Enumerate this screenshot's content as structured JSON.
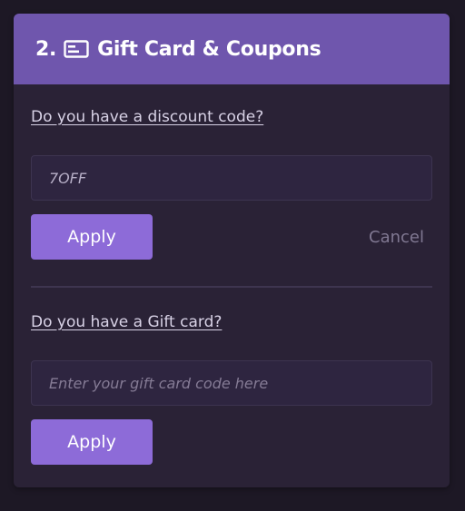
{
  "header": {
    "step": "2.",
    "icon": "credit-card-icon",
    "title": "Gift Card & Coupons"
  },
  "discount": {
    "question": "Do you have a discount code?",
    "input_value": "7OFF",
    "apply_label": "Apply",
    "cancel_label": "Cancel"
  },
  "gift_card": {
    "question": "Do you have a Gift card?",
    "input_placeholder": "Enter your gift card code here",
    "apply_label": "Apply"
  },
  "colors": {
    "header_bg": "#6f56ad",
    "panel_bg": "#2a2236",
    "page_bg": "#1d1825",
    "button_bg": "#8d6bd8"
  }
}
